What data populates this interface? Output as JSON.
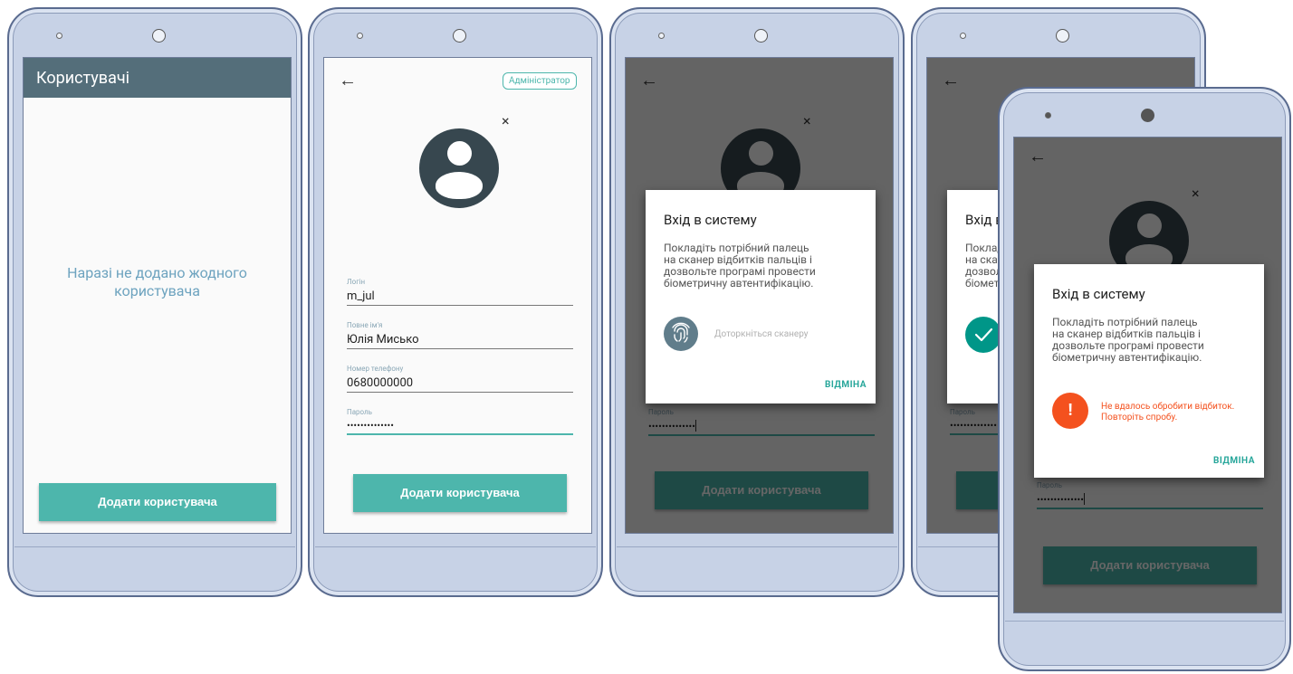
{
  "screen1": {
    "title": "Користувачі",
    "empty_line1": "Наразі не додано жодного",
    "empty_line2": "користувача",
    "add_button": "Додати користувача"
  },
  "form": {
    "back_icon": "←",
    "admin_chip": "Адміністратор",
    "close_icon": "×",
    "login_label": "Логін",
    "login_value": "m_jul",
    "fullname_label": "Повне ім'я",
    "fullname_value": "Юлія Мисько",
    "phone_label": "Номер телефону",
    "phone_value": "0680000000",
    "password_label": "Пароль",
    "password_value": "••••••••••••••",
    "add_button": "Додати користувача"
  },
  "dialog": {
    "title": "Вхід в систему",
    "body_line1": "Покладіть потрібний палець",
    "body_line2": "на сканер відбитків пальців і",
    "body_line3": "дозвольте програмі провести",
    "body_line4": "біометричну автентифікацію.",
    "touch_hint": "Доторкніться сканеру",
    "cancel": "ВІДМІНА",
    "title_partial": "Вхід в",
    "body_partial1": "Поклад",
    "body_partial2": "на скан",
    "body_partial3": "дозвол",
    "body_partial4": "біомет",
    "error_line1": "Не вдалось обробити відбиток.",
    "error_line2": "Повторіть спробу."
  },
  "colors": {
    "appbar": "#546e7a",
    "accent": "#4db6ac",
    "error": "#f4511e",
    "success": "#009688"
  },
  "icons": {
    "back": "arrow-left-icon",
    "close": "close-icon",
    "fingerprint": "fingerprint-icon",
    "success": "checkmark-icon",
    "error": "exclamation-icon"
  }
}
